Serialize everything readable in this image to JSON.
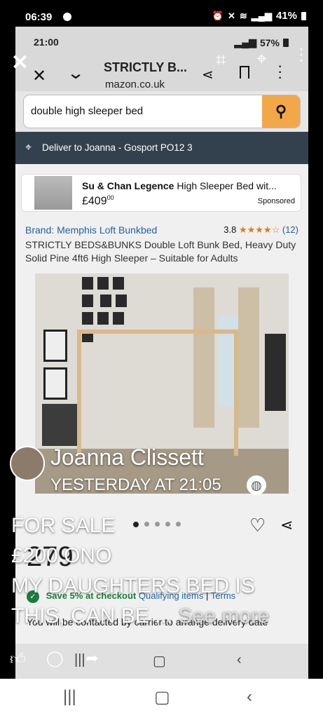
{
  "status_bar": {
    "time": "06:39",
    "battery": "41%"
  },
  "inner_status": {
    "time": "21:00",
    "battery": "57%"
  },
  "browser": {
    "title": "STRICTLY B...",
    "url": "mazon.co.uk"
  },
  "amazon": {
    "search_value": "double high sleeper bed",
    "deliver_to": "Deliver to Joanna - Gosport PO12 3",
    "sponsored": {
      "brand": "Su & Chan Legence",
      "title": "High Sleeper Bed wit...",
      "price": "£409",
      "price_pence": "00",
      "label": "Sponsored"
    },
    "product": {
      "brand": "Brand: Memphis Loft Bunkbed",
      "rating": "3.8",
      "stars": "★★★★☆",
      "review_count": "(12)",
      "title": "STRICTLY BEDS&BUNKS Double Loft Bunk Bed, Heavy Duty Solid Pine 4ft6 High Sleeper – Suitable for Adults",
      "price": "279",
      "save_text": "Save 5% at checkout",
      "qualifying": "Qualifying items",
      "sep": "|",
      "terms": "Terms",
      "delivery_note": "You will be contacted by carrier to arrange delivery date"
    },
    "carousel": {
      "count": 5,
      "active_index": 0
    }
  },
  "story": {
    "poster_name": "Joanna Clissett",
    "posted_time": "YESTERDAY AT 21:05",
    "caption_lines": [
      "FOR SALE",
      "£200 ONO",
      "MY DAUGHTERS BED IS",
      "THIS, CAN BE ..."
    ],
    "see_more": "See more"
  },
  "icons": {
    "close": "close-icon",
    "tag": "tag-icon",
    "location": "location-pin-icon",
    "more": "more-vertical-icon",
    "like": "like-icon",
    "comment": "comment-icon",
    "share": "share-icon",
    "globe": "globe-icon"
  },
  "colors": {
    "amazon_orange": "#f3a847",
    "amazon_nav": "#33414f",
    "link_blue": "#2162a1",
    "star_orange": "#e47911",
    "save_green": "#1a7c3a"
  }
}
